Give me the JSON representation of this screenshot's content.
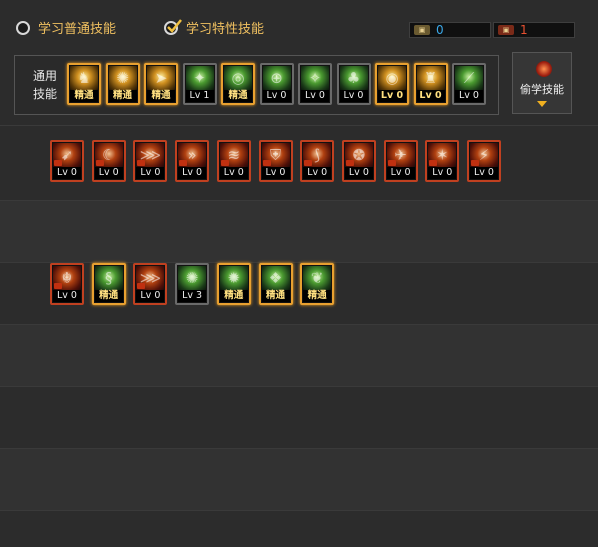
{
  "top": {
    "radio_normal": "学习普通技能",
    "radio_special": "学习特性技能",
    "points_blue": "0",
    "points_red": "1",
    "points_blue_color": "#3aa8e8",
    "points_red_color": "#e85030"
  },
  "common": {
    "title": "通用技能",
    "skills": [
      {
        "tag": "精通",
        "style": "gold",
        "icon": "figure-icon"
      },
      {
        "tag": "精通",
        "style": "gold",
        "icon": "beast-icon"
      },
      {
        "tag": "精通",
        "style": "gold",
        "icon": "dash-icon"
      },
      {
        "tag": "Lv 1",
        "style": "green",
        "icon": "wings-icon"
      },
      {
        "tag": "精通",
        "style": "gold greenart",
        "icon": "target-icon"
      },
      {
        "tag": "Lv 0",
        "style": "green",
        "icon": "crosshair-icon"
      },
      {
        "tag": "Lv 0",
        "style": "green",
        "icon": "kick-icon"
      },
      {
        "tag": "Lv 0",
        "style": "green",
        "icon": "mushroom-icon"
      },
      {
        "tag": "Lv 0",
        "style": "gold",
        "icon": "eye-icon"
      },
      {
        "tag": "Lv 0",
        "style": "gold",
        "icon": "warrior-icon"
      },
      {
        "tag": "Lv 0",
        "style": "green",
        "icon": "slash-icon"
      }
    ]
  },
  "steal": {
    "label": "偷学技能",
    "icon": "steal-icon",
    "arrow": "dropdown-arrow-icon"
  },
  "row1": [
    {
      "tag": "Lv 0",
      "style": "red",
      "icon": "runner-icon"
    },
    {
      "tag": "Lv 0",
      "style": "red",
      "icon": "crescent-icon"
    },
    {
      "tag": "Lv 0",
      "style": "red",
      "icon": "claw-icon"
    },
    {
      "tag": "Lv 0",
      "style": "red",
      "icon": "arrows-icon"
    },
    {
      "tag": "Lv 0",
      "style": "red",
      "icon": "wave-icon"
    },
    {
      "tag": "Lv 0",
      "style": "red",
      "icon": "shield-icon"
    },
    {
      "tag": "Lv 0",
      "style": "red",
      "icon": "blade-icon"
    },
    {
      "tag": "Lv 0",
      "style": "red",
      "icon": "spin-icon"
    },
    {
      "tag": "Lv 0",
      "style": "red",
      "icon": "bird-icon"
    },
    {
      "tag": "Lv 0",
      "style": "red",
      "icon": "burst-icon"
    },
    {
      "tag": "Lv 0",
      "style": "red",
      "icon": "strike-icon"
    }
  ],
  "row2": [
    {
      "tag": "Lv 0",
      "style": "red",
      "icon": "dragon-icon"
    },
    {
      "tag": "精通",
      "style": "gold greenart",
      "icon": "serpent-icon"
    },
    {
      "tag": "Lv 0",
      "style": "red",
      "icon": "claw-icon"
    },
    {
      "tag": "Lv 3",
      "style": "green",
      "icon": "beast-icon"
    },
    {
      "tag": "精通",
      "style": "gold greenart",
      "icon": "storm-icon"
    },
    {
      "tag": "精通",
      "style": "gold greenart",
      "icon": "tiger-icon"
    },
    {
      "tag": "精通",
      "style": "gold greenart",
      "icon": "phoenix-icon"
    }
  ]
}
